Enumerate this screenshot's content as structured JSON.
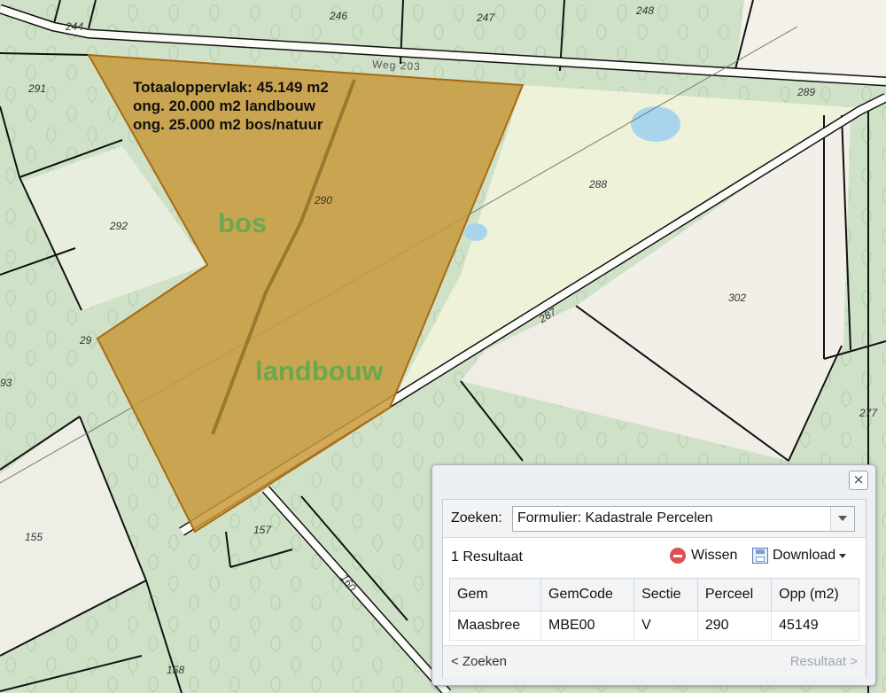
{
  "map": {
    "parcel_numbers": [
      "244",
      "246",
      "247",
      "248",
      "291",
      "289",
      "288",
      "290",
      "292",
      "302",
      "287",
      "29",
      "93",
      "277",
      "155",
      "157",
      "160",
      "158"
    ],
    "road_label": "Weg 203",
    "selected_parcel": {
      "fill": "#c99a3c",
      "stroke": "#a86a12"
    },
    "annotation": {
      "line1": "Totaaloppervlak: 45.149 m2",
      "line2": "ong. 20.000 m2 landbouw",
      "line3": "ong. 25.000 m2 bos/natuur"
    },
    "area_labels": {
      "bos": "bos",
      "landbouw": "landbouw"
    },
    "label_color": "#6aa84f"
  },
  "panel": {
    "close_label": "×",
    "search_label": "Zoeken:",
    "search_value": "Formulier: Kadastrale Percelen",
    "result_count": "1 Resultaat",
    "wissen_label": "Wissen",
    "download_label": "Download",
    "columns": [
      "Gem",
      "GemCode",
      "Sectie",
      "Perceel",
      "Opp (m2)"
    ],
    "rows": [
      [
        "Maasbree",
        "MBE00",
        "V",
        "290",
        "45149"
      ]
    ],
    "back_label": "< Zoeken",
    "next_label": "Resultaat >"
  }
}
